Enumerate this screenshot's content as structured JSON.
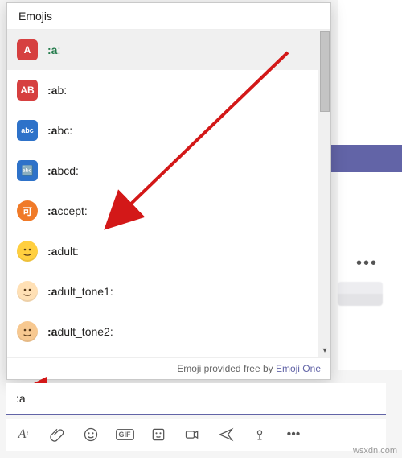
{
  "popup": {
    "title": "Emojis",
    "footer_prefix": "Emoji provided free by ",
    "footer_link": "Emoji One",
    "items": [
      {
        "icon_class": "red",
        "icon_text": "A",
        "match": ":a",
        "rest": ":",
        "selected": true
      },
      {
        "icon_class": "red",
        "icon_text": "AB",
        "match": ":a",
        "rest": "b:",
        "selected": false
      },
      {
        "icon_class": "blue",
        "icon_text": "abc",
        "match": ":a",
        "rest": "bc:",
        "selected": false
      },
      {
        "icon_class": "blue",
        "icon_text": "🔤",
        "match": ":a",
        "rest": "bcd:",
        "selected": false
      },
      {
        "icon_class": "orange",
        "icon_text": "可",
        "match": ":a",
        "rest": "ccept:",
        "selected": false
      },
      {
        "icon_class": "face",
        "icon_text": "",
        "match": ":a",
        "rest": "dult:",
        "selected": false
      },
      {
        "icon_class": "face light",
        "icon_text": "",
        "match": ":a",
        "rest": "dult_tone1:",
        "selected": false
      },
      {
        "icon_class": "face med",
        "icon_text": "",
        "match": ":a",
        "rest": "dult_tone2:",
        "selected": false
      }
    ]
  },
  "compose": {
    "typed": ":a"
  },
  "toolbar": {
    "format": "Aᵢ",
    "gif": "GIF",
    "more": "•••"
  },
  "watermark": "wsxdn.com"
}
